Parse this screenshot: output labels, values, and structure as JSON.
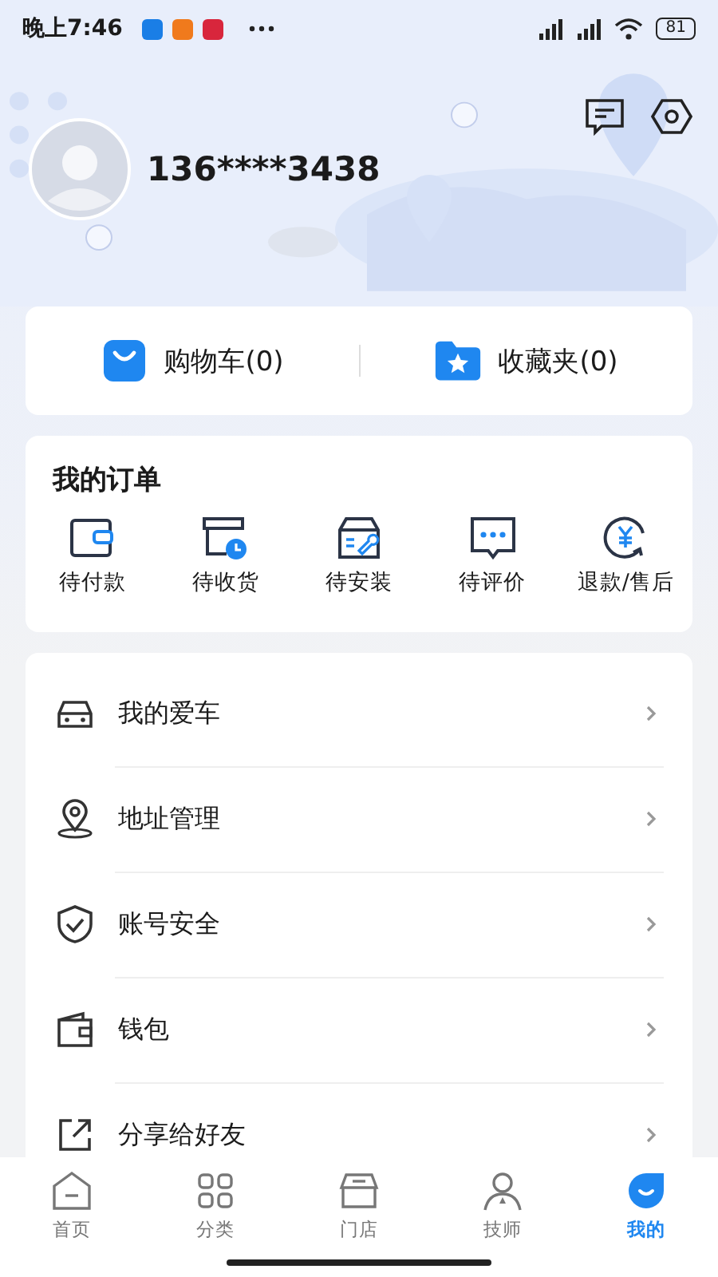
{
  "status_bar": {
    "time": "晚上7:46",
    "battery": "81"
  },
  "profile": {
    "phone": "136****3438"
  },
  "shortcuts": [
    {
      "label": "购物车(0)"
    },
    {
      "label": "收藏夹(0)"
    }
  ],
  "orders": {
    "title": "我的订单",
    "items": [
      "待付款",
      "待收货",
      "待安装",
      "待评价",
      "退款/售后"
    ]
  },
  "menu": {
    "items": [
      "我的爱车",
      "地址管理",
      "账号安全",
      "钱包",
      "分享给好友"
    ]
  },
  "tab_bar": {
    "items": [
      {
        "label": "首页",
        "selected": false
      },
      {
        "label": "分类",
        "selected": false
      },
      {
        "label": "门店",
        "selected": false
      },
      {
        "label": "技师",
        "selected": false
      },
      {
        "label": "我的",
        "selected": true
      }
    ]
  }
}
